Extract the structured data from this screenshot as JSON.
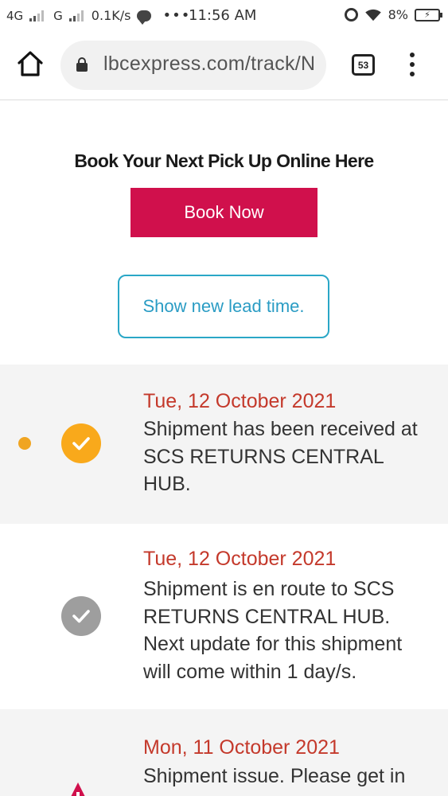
{
  "status_bar": {
    "network_1": "4G",
    "network_2": "G",
    "speed": "0.1K/s",
    "dots": "•••",
    "time": "11:56 AM",
    "battery": "8%",
    "icons": [
      "signal-icon",
      "chat-icon",
      "alarm-icon",
      "wifi-icon",
      "battery-icon"
    ]
  },
  "browser": {
    "url": "lbcexpress.com/track/N",
    "tab_count": "53",
    "icons": [
      "home-icon",
      "lock-icon",
      "tabs-icon",
      "more-menu-icon"
    ]
  },
  "booking": {
    "heading": "Book Your Next Pick Up Online Here",
    "book_button": "Book Now",
    "lead_time_button": "Show new lead time."
  },
  "timeline": [
    {
      "date": "Tue, 12 October 2021",
      "message": "Shipment has been received at SCS RETURNS CENTRAL HUB.",
      "status": "current"
    },
    {
      "date": "Tue, 12 October 2021",
      "message": "Shipment is en route to SCS RETURNS CENTRAL HUB. Next update for this shipment will come within 1 day/s.",
      "status": "completed"
    },
    {
      "date": "Mon, 11 October 2021",
      "message": "Shipment issue. Please get in",
      "status": "issue"
    }
  ],
  "colors": {
    "book_button": "#d0104c",
    "lead_button_border": "#2aa7c7",
    "date_text": "#c4392b",
    "current_dot": "#f0a522",
    "check_current": "#f9a91b",
    "check_completed": "#9e9e9e",
    "issue_icon": "#d0104c"
  }
}
